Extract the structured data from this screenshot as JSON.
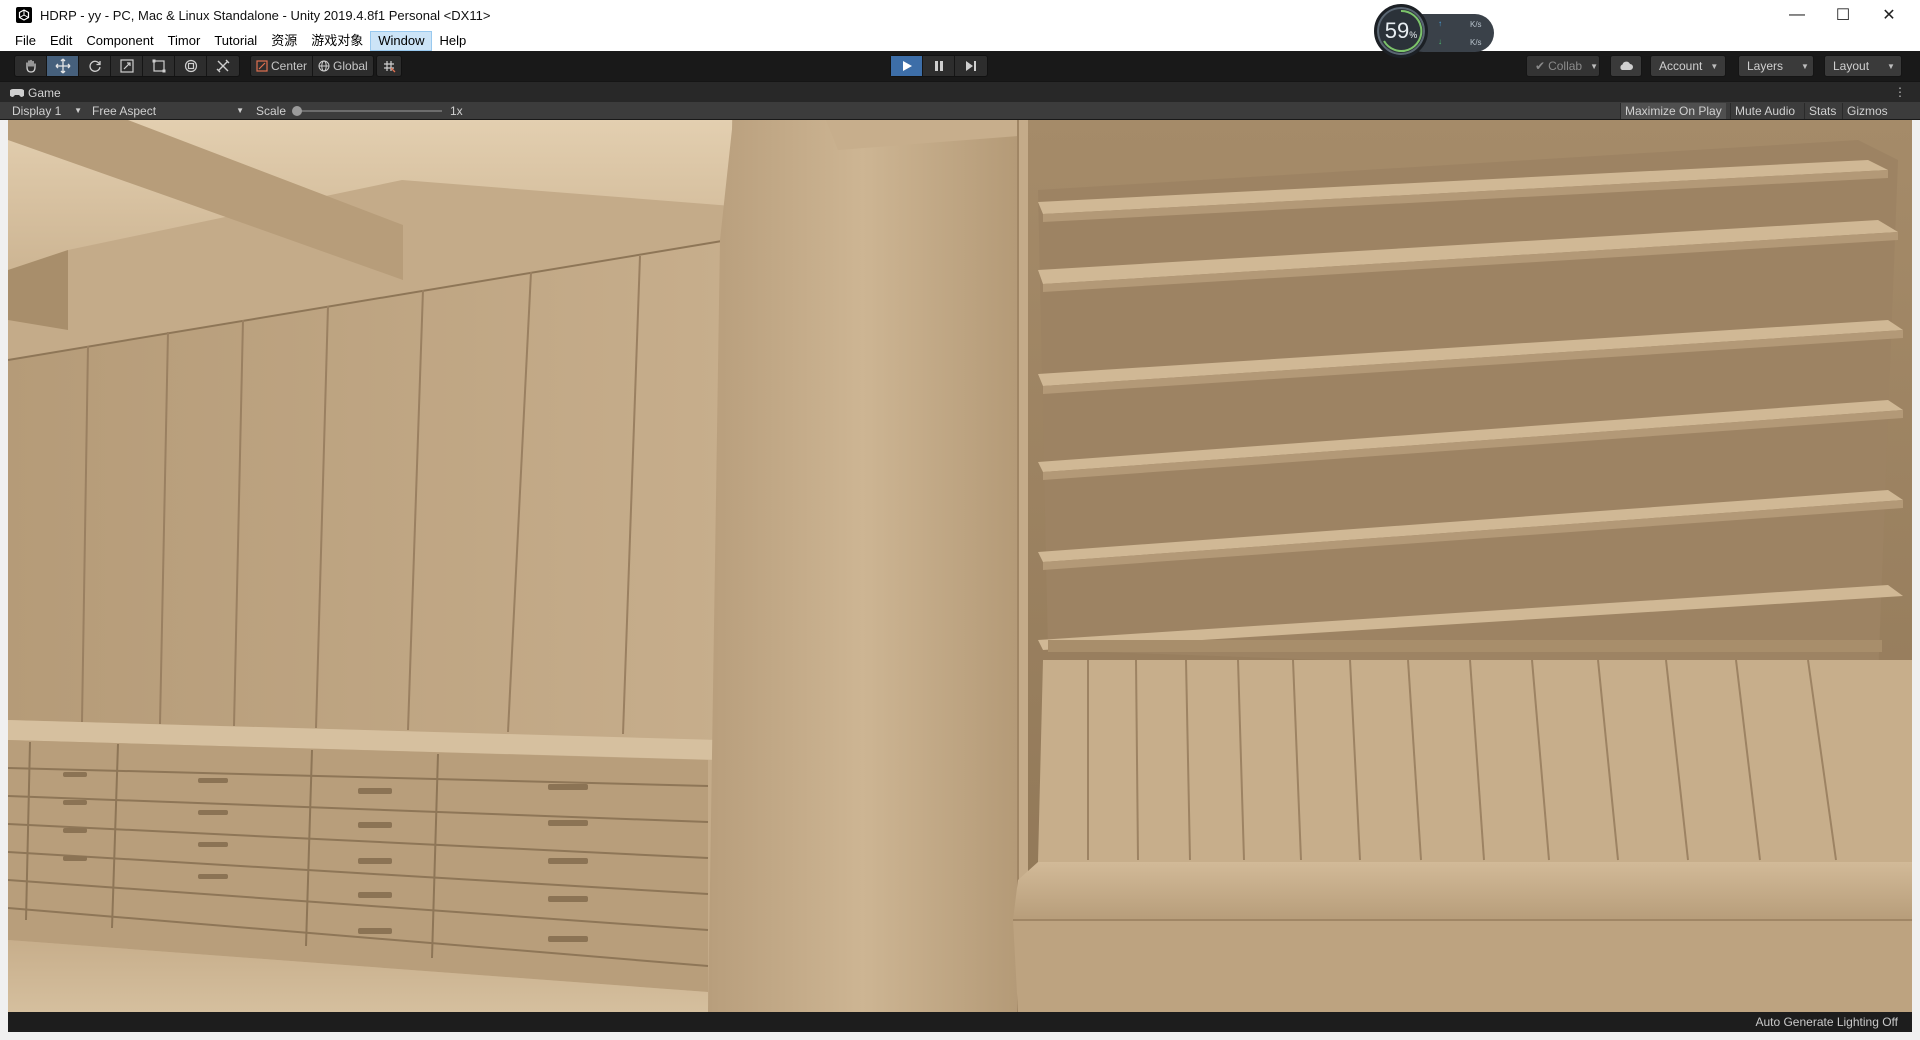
{
  "window": {
    "title": "HDRP - yy - PC, Mac & Linux Standalone - Unity 2019.4.8f1 Personal <DX11>",
    "controls": {
      "minimize": "—",
      "maximize": "☐",
      "close": "✕"
    }
  },
  "fps_widget": {
    "value": "59",
    "unit": "%",
    "rate_up": "K/s",
    "rate_down": "K/s"
  },
  "menu": {
    "items": [
      "File",
      "Edit",
      "Component",
      "Timor",
      "Tutorial",
      "资源",
      "游戏对象",
      "Window",
      "Help"
    ],
    "active": "Window"
  },
  "toolbar": {
    "tools": [
      "hand-tool",
      "move-tool",
      "rotate-tool",
      "scale-tool",
      "rect-tool",
      "transform-tool",
      "custom-tool"
    ],
    "selected_tool": "move-tool",
    "pivot_center": "Center",
    "pivot_global": "Global",
    "play_controls": [
      "play",
      "pause",
      "step"
    ],
    "collab": "Collab",
    "account": "Account",
    "layers": "Layers",
    "layout": "Layout",
    "accent": "#3d6ea8"
  },
  "game_view": {
    "tab_label": "Game",
    "display": "Display 1",
    "aspect": "Free Aspect",
    "scale_label": "Scale",
    "scale_value": "1x",
    "scale_fraction": 0.0,
    "maximize_on_play": "Maximize On Play",
    "mute_audio": "Mute Audio",
    "stats": "Stats",
    "gizmos": "Gizmos"
  },
  "status": {
    "lighting": "Auto Generate Lighting Off"
  },
  "colors": {
    "scene_base": "#c4ab89",
    "scene_dark": "#8e7657",
    "scene_light": "#dcc6a6",
    "editor_dark": "#191919",
    "editor_panel": "#3c3c3c"
  }
}
